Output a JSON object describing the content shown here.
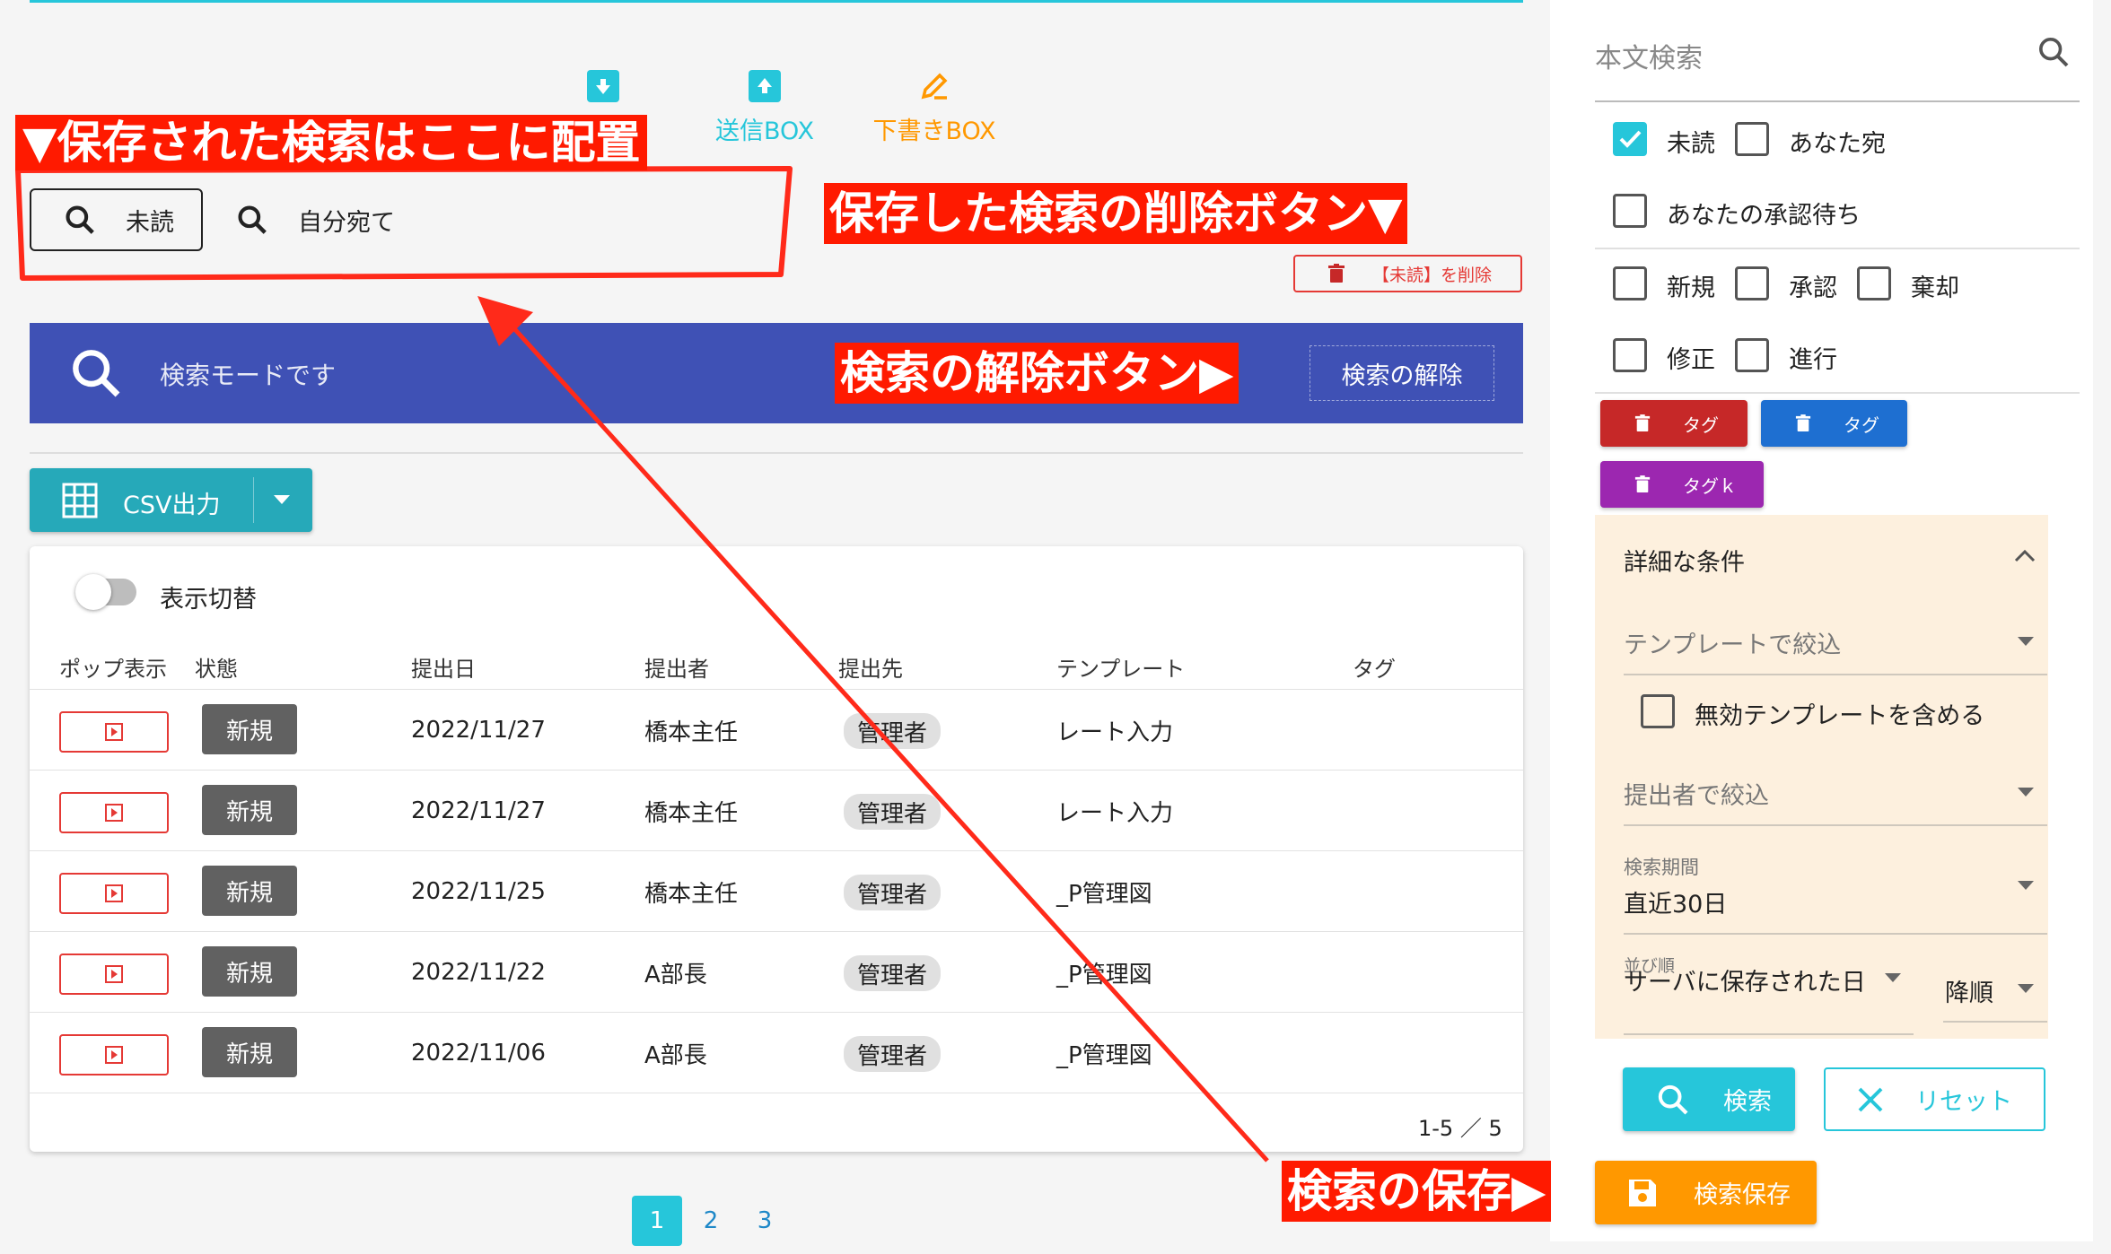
{
  "boxes": {
    "sent": "送信BOX",
    "draft": "下書きBOX"
  },
  "saved_searches": [
    "未読",
    "自分宛て"
  ],
  "delete_saved_label": "【未読】を削除",
  "banner": {
    "text": "検索モードです",
    "release_label": "検索の解除"
  },
  "csv": {
    "label": "CSV出力"
  },
  "toggle_label": "表示切替",
  "table": {
    "headers": [
      "ポップ表示",
      "状態",
      "提出日",
      "提出者",
      "提出先",
      "テンプレート",
      "タグ"
    ],
    "rows": [
      {
        "status": "新規",
        "date": "2022/11/27",
        "submitter": "橋本主任",
        "dest": "管理者",
        "template": "レート入力"
      },
      {
        "status": "新規",
        "date": "2022/11/27",
        "submitter": "橋本主任",
        "dest": "管理者",
        "template": "レート入力"
      },
      {
        "status": "新規",
        "date": "2022/11/25",
        "submitter": "橋本主任",
        "dest": "管理者",
        "template": "_P管理図"
      },
      {
        "status": "新規",
        "date": "2022/11/22",
        "submitter": "A部長",
        "dest": "管理者",
        "template": "_P管理図"
      },
      {
        "status": "新規",
        "date": "2022/11/06",
        "submitter": "A部長",
        "dest": "管理者",
        "template": "_P管理図"
      }
    ],
    "range": "1-5 ／ 5"
  },
  "pagination": {
    "pages": [
      "1",
      "2",
      "3"
    ],
    "current": "1"
  },
  "annotations": {
    "saved_here": "▼保存された検索はここに配置",
    "delete_button": "保存した検索の削除ボタン▼",
    "release_button": "検索の解除ボタン▶",
    "save_search": "検索の保存▶"
  },
  "sidebar": {
    "search_placeholder": "本文検索",
    "checkboxes": [
      {
        "label": "未読",
        "checked": true
      },
      {
        "label": "あなた宛",
        "checked": false
      },
      {
        "label": "あなたの承認待ち",
        "checked": false
      },
      {
        "label": "新規",
        "checked": false
      },
      {
        "label": "承認",
        "checked": false
      },
      {
        "label": "棄却",
        "checked": false
      },
      {
        "label": "修正",
        "checked": false
      },
      {
        "label": "進行",
        "checked": false
      }
    ],
    "tags": [
      {
        "label": "タグ",
        "color": "#c62828"
      },
      {
        "label": "タグ",
        "color": "#1e6fd1"
      },
      {
        "label": "タグｋ",
        "color": "#9c27b0"
      }
    ],
    "conditions": {
      "title": "詳細な条件",
      "template_filter": "テンプレートで絞込",
      "include_disabled": "無効テンプレートを含める",
      "submitter_filter": "提出者で絞込",
      "period_label": "検索期間",
      "period_value": "直近30日",
      "sort_label": "並び順",
      "sort_value": "サーバに保存された日",
      "order_value": "降順"
    },
    "search_button": "検索",
    "reset_button": "リセット",
    "save_button": "検索保存"
  },
  "colors": {
    "accent": "#26c6da",
    "banner": "#3f51b5",
    "save": "#ff9800",
    "annotation": "#ff1a00"
  }
}
